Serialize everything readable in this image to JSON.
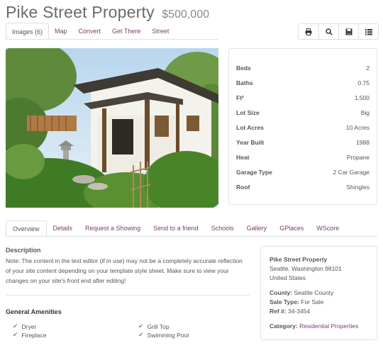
{
  "listing": {
    "title": "Pike Street Property",
    "price": "$500,000"
  },
  "media_tabs": [
    "Images (6)",
    "Map",
    "Convert",
    "Get There",
    "Street"
  ],
  "toolbar_icons": [
    "print-icon",
    "search-icon",
    "save-icon",
    "list-icon"
  ],
  "details": [
    {
      "label": "Beds",
      "value": "2"
    },
    {
      "label": "Baths",
      "value": "0.75"
    },
    {
      "label": "Ft²",
      "value": "1,500"
    },
    {
      "label": "Lot Size",
      "value": "Big"
    },
    {
      "label": "Lot Acres",
      "value": "10 Acres"
    },
    {
      "label": "Year Built",
      "value": "1988"
    },
    {
      "label": "Heat",
      "value": "Propane"
    },
    {
      "label": "Garage Type",
      "value": "2 Car Garage"
    },
    {
      "label": "Roof",
      "value": "Shingles"
    }
  ],
  "section_tabs": [
    "Overview",
    "Details",
    "Request a Showing",
    "Send to a friend",
    "Schools",
    "Gallery",
    "GPlaces",
    "WScore"
  ],
  "description": {
    "heading": "Description",
    "text": "Note: The content in the text editor (if in use) may not be a completely accurate reflection of your site content depending on your template style sheet. Make sure to view your changes on your site's front end after editing!"
  },
  "amenities": {
    "heading": "General Amenities",
    "items": [
      "Dryer",
      "Fireplace",
      "Grill Top",
      "Swimming Pool"
    ]
  },
  "card": {
    "name": "Pike Street Property",
    "city": "Seattle, Washington 98101",
    "country": "United States",
    "county_label": "County:",
    "county_value": "Seattle County",
    "sale_label": "Sale Type:",
    "sale_value": "For Sale",
    "ref_label": "Ref #:",
    "ref_value": "34-3454",
    "category_label": "Category:",
    "category_value": "Residential Properties"
  },
  "colors": {
    "accent": "#7a3b6e",
    "text": "#555555",
    "border": "#dddddd"
  }
}
